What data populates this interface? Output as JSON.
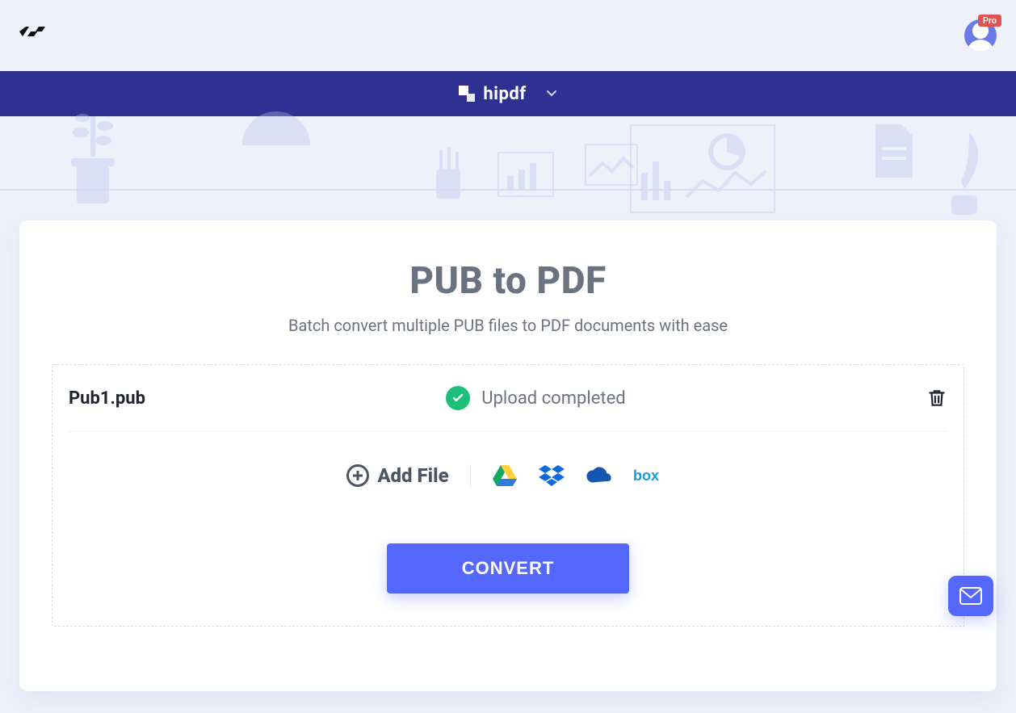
{
  "header": {
    "account_badge": "Pro"
  },
  "menubar": {
    "brand": "hipdf"
  },
  "main": {
    "title": "PUB to PDF",
    "subtitle": "Batch convert multiple PUB files to PDF documents with ease",
    "file": {
      "name": "Pub1.pub",
      "status": "Upload completed"
    },
    "add_file_label": "Add File",
    "convert_button": "CONVERT"
  }
}
